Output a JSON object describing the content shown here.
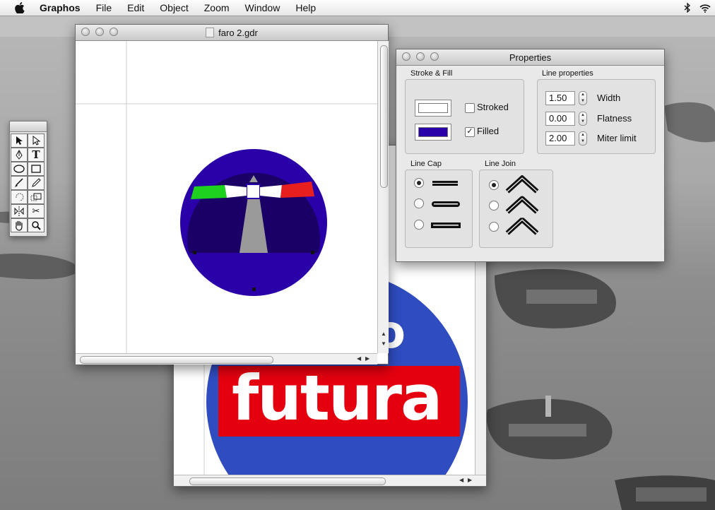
{
  "menubar": {
    "app_name": "Graphos",
    "items": [
      "File",
      "Edit",
      "Object",
      "Zoom",
      "Window",
      "Help"
    ]
  },
  "document_window": {
    "title": "faro 2.gdr"
  },
  "background_document": {
    "logo_word": "futura",
    "logo_partial_letter": "o"
  },
  "tool_palette": {
    "tools": [
      "arrow-select-icon",
      "direct-select-icon",
      "pen-icon",
      "text-icon",
      "ellipse-icon",
      "rectangle-icon",
      "brush-icon",
      "pencil-icon",
      "rotate-icon",
      "scale-icon",
      "reflect-icon",
      "scissors-icon",
      "hand-icon",
      "zoom-icon"
    ],
    "text_tool_glyph": "T"
  },
  "properties": {
    "title": "Properties",
    "stroke_fill": {
      "label": "Stroke & Fill",
      "stroked_label": "Stroked",
      "stroked": false,
      "filled_label": "Filled",
      "filled": true,
      "stroke_color": "#ffffff",
      "fill_color": "#2a00a8"
    },
    "line_properties": {
      "label": "Line properties",
      "width_value": "1.50",
      "width_label": "Width",
      "flatness_value": "0.00",
      "flatness_label": "Flatness",
      "miter_value": "2.00",
      "miter_label": "Miter limit"
    },
    "line_cap": {
      "label": "Line Cap",
      "options": [
        "butt-cap",
        "round-cap",
        "square-cap"
      ],
      "selected": 0
    },
    "line_join": {
      "label": "Line Join",
      "options": [
        "miter-join",
        "round-join",
        "bevel-join"
      ],
      "selected": 0
    }
  },
  "colors": {
    "logo_outer": "#2a00a8",
    "logo_inner": "#1a0066",
    "green": "#1fd11f",
    "red": "#e81f1f",
    "futura_blue": "#2f4cc0",
    "futura_red": "#e4000f"
  }
}
